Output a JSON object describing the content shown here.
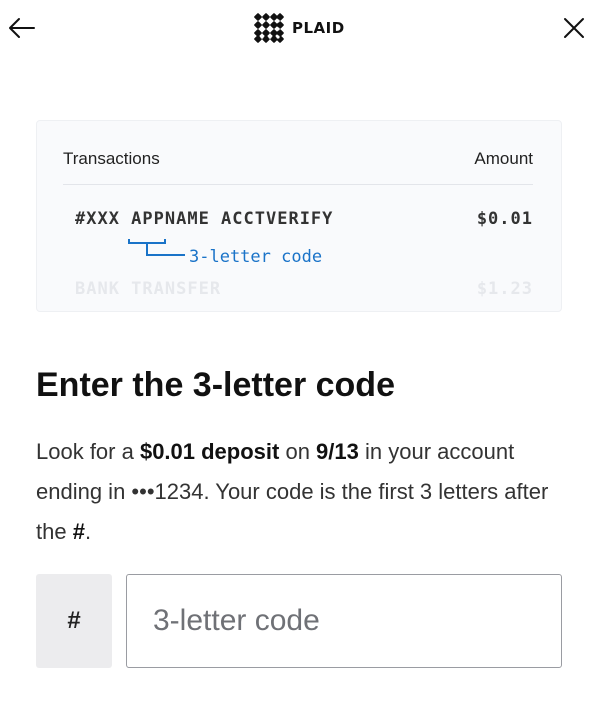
{
  "header": {
    "logo_text": "PLAID",
    "back_icon": "arrow-left-icon",
    "close_icon": "close-icon"
  },
  "example_card": {
    "col_transactions": "Transactions",
    "col_amount": "Amount",
    "main_row": {
      "description": "#XXX APPNAME ACCTVERIFY",
      "amount": "$0.01"
    },
    "hint": "3-letter code",
    "faded_row": {
      "description": "BANK TRANSFER",
      "amount": "$1.23"
    }
  },
  "content": {
    "title": "Enter the 3-letter code",
    "desc_p1": "Look for a ",
    "desc_amount": "$0.01 deposit",
    "desc_p2": " on ",
    "desc_date": "9/13",
    "desc_p3": " in your account ending in •••1234. Your code is the first 3 letters after the ",
    "desc_hash": "#",
    "desc_p4": "."
  },
  "form": {
    "prefix": "#",
    "code_placeholder": "3-letter code",
    "code_value": ""
  },
  "colors": {
    "accent": "#1a73c8"
  }
}
